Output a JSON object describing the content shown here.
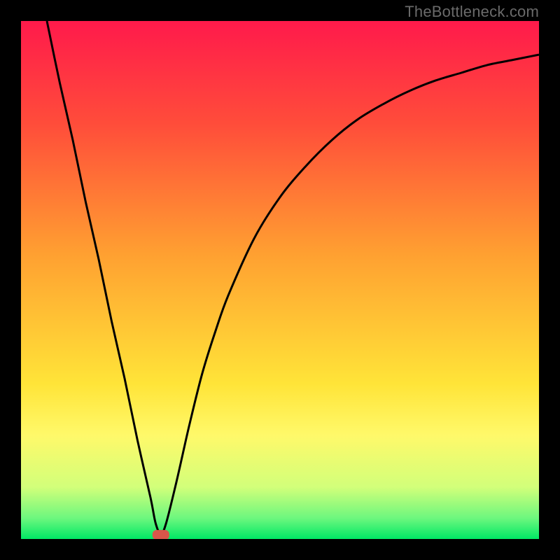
{
  "watermark": "TheBottleneck.com",
  "chart_data": {
    "type": "line",
    "title": "",
    "xlabel": "",
    "ylabel": "",
    "xlim": [
      0,
      100
    ],
    "ylim": [
      0,
      100
    ],
    "series": [
      {
        "name": "curve",
        "color": "#000000",
        "x": [
          5,
          7.5,
          10,
          12.5,
          15,
          17.5,
          20,
          22.5,
          25,
          26,
          27,
          28,
          30,
          32.5,
          35,
          37.5,
          40,
          45,
          50,
          55,
          60,
          65,
          70,
          75,
          80,
          85,
          90,
          95,
          100
        ],
        "y": [
          100,
          88,
          77,
          65,
          54,
          42,
          31,
          19,
          8,
          3,
          1,
          3,
          11,
          22,
          32,
          40,
          47,
          58,
          66,
          72,
          77,
          81,
          84,
          86.5,
          88.5,
          90,
          91.5,
          92.5,
          93.5
        ]
      }
    ],
    "marker": {
      "name": "optimum",
      "x": 27,
      "y": 0.8,
      "color": "#d9564a"
    },
    "gradient_stops": [
      {
        "offset": 0,
        "color": "#ff1a4b"
      },
      {
        "offset": 20,
        "color": "#ff4d3a"
      },
      {
        "offset": 45,
        "color": "#ffa031"
      },
      {
        "offset": 70,
        "color": "#ffe438"
      },
      {
        "offset": 80,
        "color": "#fff96a"
      },
      {
        "offset": 90,
        "color": "#d2ff7a"
      },
      {
        "offset": 96,
        "color": "#6cf77e"
      },
      {
        "offset": 100,
        "color": "#00e865"
      }
    ]
  }
}
